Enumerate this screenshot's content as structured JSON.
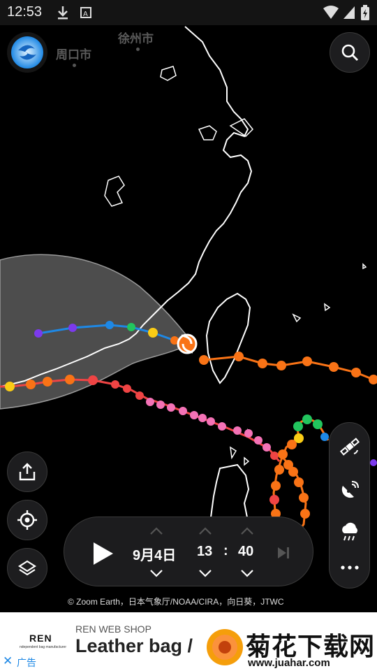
{
  "status_bar": {
    "time": "12:53"
  },
  "map": {
    "cities": [
      {
        "name": "周口市"
      },
      {
        "name": "徐州市"
      }
    ],
    "storm_icon": "typhoon-icon"
  },
  "controls": {
    "logo_icon": "zoom-earth-logo-icon",
    "search_icon": "search-icon",
    "share_icon": "share-icon",
    "locate_icon": "crosshair-icon",
    "layers_icon": "layers-icon",
    "panel": [
      "satellite-icon",
      "radar-icon",
      "rain-icon",
      "more-icon"
    ]
  },
  "timebar": {
    "date": "9月4日",
    "hour": "13",
    "separator": ":",
    "minute": "40"
  },
  "credits": "© Zoom Earth，日本气象厅/NOAA/CIRA，向日葵，JTWC",
  "ad": {
    "brand": "REN",
    "brand_sub": "ndependent bag manufacturer",
    "shop": "REN WEB SHOP",
    "headline": "Leather bag / ",
    "close": "✕",
    "label": "广告"
  },
  "watermark": {
    "title": "菊花下载网",
    "url": "www.juahar.com"
  },
  "colors": {
    "accent_blue": "#1e88e5",
    "panel": "#1d1d1f",
    "coast": "#ffffff"
  }
}
